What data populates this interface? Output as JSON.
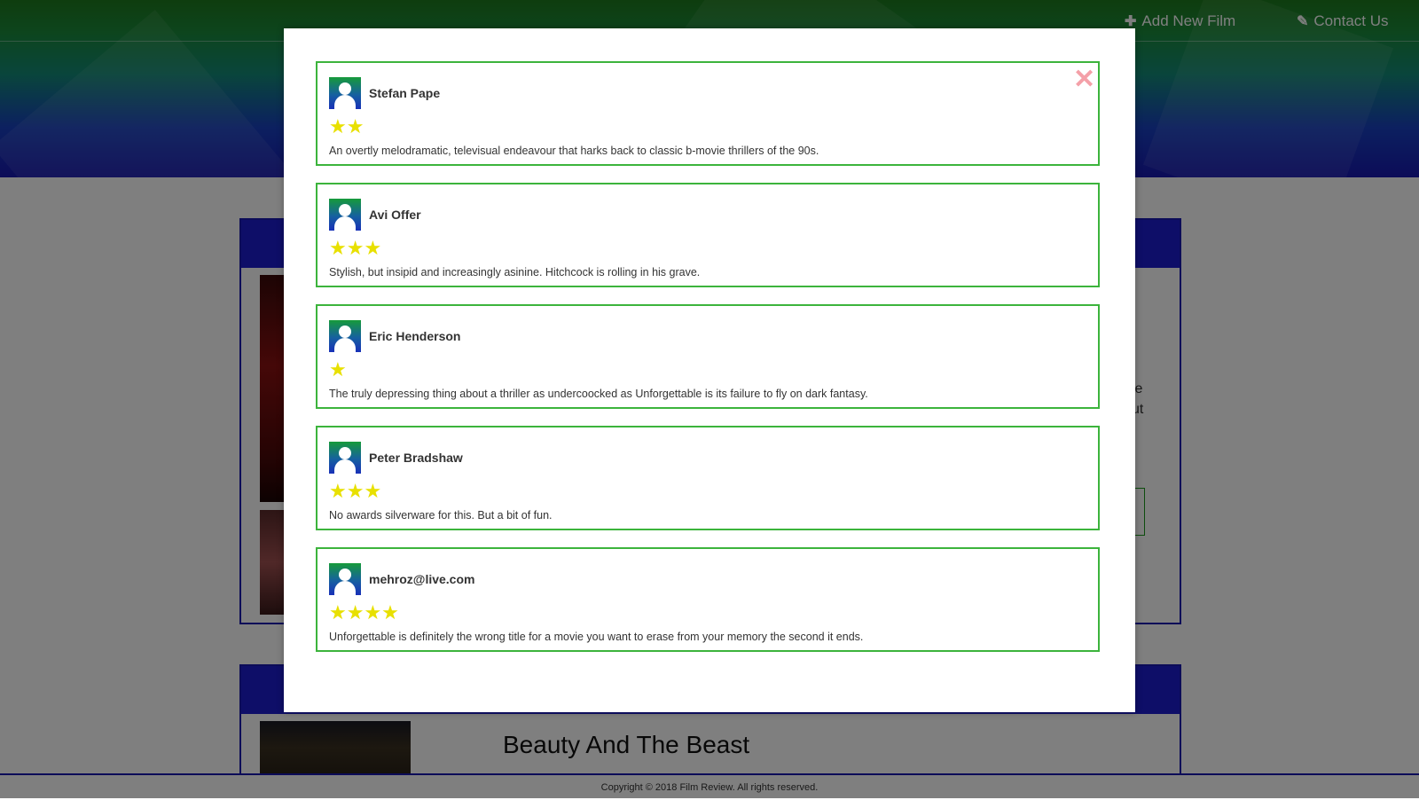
{
  "nav": {
    "add_film_icon": "plus-icon",
    "add_film_label": "Add New Film",
    "contact_icon": "edit-square-icon",
    "contact_label": "Contact Us"
  },
  "background": {
    "partial_text_1": "le",
    "partial_text_2": "ut",
    "film_title": "Beauty And The Beast"
  },
  "footer": {
    "copyright": "Copyright © 2018 Film Review. All rights reserved."
  },
  "modal": {
    "close_icon": "close-icon",
    "reviews": [
      {
        "reviewer": "Stefan Pape",
        "rating": 2,
        "stars": "★★",
        "text": "An overtly melodramatic, televisual endeavour that harks back to classic b-movie thrillers of the 90s."
      },
      {
        "reviewer": "Avi Offer",
        "rating": 3,
        "stars": "★★★",
        "text": "Stylish, but insipid and increasingly asinine. Hitchcock is rolling in his grave."
      },
      {
        "reviewer": "Eric Henderson",
        "rating": 1,
        "stars": "★",
        "text": "The truly depressing thing about a thriller as undercoocked as Unforgettable is its failure to fly on dark fantasy."
      },
      {
        "reviewer": "Peter Bradshaw",
        "rating": 3,
        "stars": "★★★",
        "text": "No awards silverware for this. But a bit of fun."
      },
      {
        "reviewer": "mehroz@live.com",
        "rating": 4,
        "stars": "★★★★",
        "text": "Unforgettable is definitely the wrong title for a movie you want to erase from your memory the second it ends."
      }
    ]
  },
  "colors": {
    "accent_green": "#3cb43c",
    "header_blue": "#1c1cd0",
    "star_yellow": "#e8e000",
    "close_pink": "#f4a0a8"
  }
}
